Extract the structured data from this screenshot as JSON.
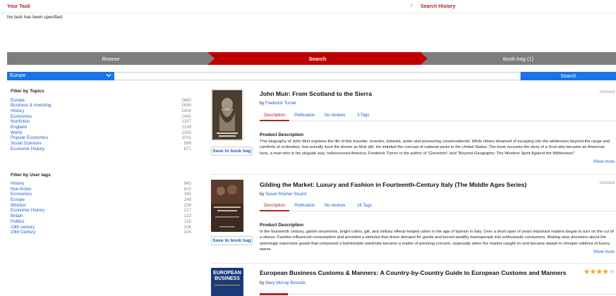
{
  "header": {
    "task_title": "Your Task",
    "help_glyph": "?",
    "search_history": "Search History",
    "no_task_text": "No task has been specified"
  },
  "steps": {
    "browse": "Browse",
    "search": "Search",
    "bookbag": "Book-bag (1)"
  },
  "searchbar": {
    "category": "Europe",
    "chevron_icon": "chevron-down-icon",
    "query": "",
    "button": "Search"
  },
  "topics": {
    "title": "Filter by Topics",
    "items": [
      {
        "label": "Europe",
        "count": "2680"
      },
      {
        "label": "Business & Investing",
        "count": "2686"
      },
      {
        "label": "History",
        "count": "2404"
      },
      {
        "label": "Economics",
        "count": "1442"
      },
      {
        "label": "Nonfiction",
        "count": "1297"
      },
      {
        "label": "England",
        "count": "1199"
      },
      {
        "label": "World",
        "count": "1059"
      },
      {
        "label": "Popular Economics",
        "count": "1011"
      },
      {
        "label": "Social Sciences",
        "count": "986"
      },
      {
        "label": "Economic History",
        "count": "671"
      }
    ]
  },
  "usertags": {
    "title": "Filter by User tags",
    "items": [
      {
        "label": "History",
        "count": "943"
      },
      {
        "label": "Non-fiction",
        "count": "615"
      },
      {
        "label": "Economics",
        "count": "349"
      },
      {
        "label": "Europe",
        "count": "248"
      },
      {
        "label": "Wishlist",
        "count": "238"
      },
      {
        "label": "Economic History",
        "count": "217"
      },
      {
        "label": "Britain",
        "count": "122"
      },
      {
        "label": "Politics",
        "count": "118"
      },
      {
        "label": "19th century",
        "count": "106"
      },
      {
        "label": "20th Century",
        "count": "104"
      }
    ]
  },
  "books": [
    {
      "title": "John Muir: From Scotland to the Sierra",
      "author_prefix": "by",
      "author": "Frederick Turner",
      "rating_text": "Unrated",
      "save_label": "Save to book bag",
      "tabs": {
        "description": "Description",
        "publication": "Publication",
        "reviews": "No reviews",
        "tags": "3 Tags"
      },
      "pd_title": "Product Description",
      "description": "This biography of John Muir explores the life of this traveller, inventor, botanist, writer and pioneering conservationist. While others dreamed of escaping into the wilderness beyond the range and comforts of civilization, few actually lived the dream as Muir did. He initiated the concept of national parks in the United States. The book recounts the story of a Scot who became an American hero, a man who in his singular way, rediscovered America. Frederick Turner is the author of \"Geronimo\" and \"Beyond Geography: The Western Spirit Against the Wilderness\".",
      "show_more": "Show more",
      "cover_color": "#5b4a3b"
    },
    {
      "title": "Gilding the Market: Luxury and Fashion in Fourteenth-Century Italy (The Middle Ages Series)",
      "author_prefix": "by",
      "author": "Susan Mosher Stuard",
      "rating_text": "Unrated",
      "save_label": "Save to book bag",
      "tabs": {
        "description": "Description",
        "publication": "Publication",
        "reviews": "No reviews",
        "tags": "16 Tags"
      },
      "pd_title": "Product Description",
      "description": "In the fourteenth century, garish ornaments, bright colors, gilt, and military effects helped usher in the age of fashion in Italy. Over a short span of years important matters began to turn on the cut of a sleeve. Fashion influenced consumption and provided a stimulus that drove demand for goods and turned wealthy townspeople into enthusiastic consumers. Making wise decisions about the alarmingly expensive goods that composed a fashionable wardrobe became a matter of pressing concern, especially when the market caught on and became awash in cheaper editions of luxury wares.",
      "show_more": "Show more",
      "cover_color": "#4a3328"
    },
    {
      "title": "European Business Customs & Manners: A Country-by-Country Guide to European Customs and Manners",
      "author_prefix": "by",
      "author": "Mary Murray Bosrock",
      "rating": 4,
      "rating_max": 5,
      "cover_lines": [
        "EUROPEAN",
        "BUSINESS"
      ],
      "cover_color": "#1c3a78"
    }
  ],
  "colors": {
    "accent_red": "#b22222",
    "link_blue": "#1a5fd1",
    "primary_blue": "#1a73e8",
    "step_gray": "#7d7d7d",
    "step_active": "#bf0000",
    "star": "#f2a61f"
  }
}
